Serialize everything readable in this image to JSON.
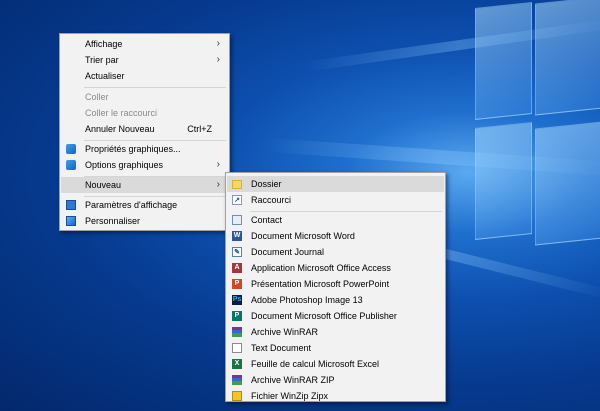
{
  "context_menu": {
    "items": [
      {
        "label": "Affichage",
        "arrow": "›"
      },
      {
        "label": "Trier par",
        "arrow": "›"
      },
      {
        "label": "Actualiser"
      },
      {
        "label": "Coller"
      },
      {
        "label": "Coller le raccourci"
      },
      {
        "label": "Annuler Nouveau",
        "shortcut": "Ctrl+Z"
      },
      {
        "label": "Propriétés graphiques...",
        "icon": "intel-graphics-icon"
      },
      {
        "label": "Options graphiques",
        "arrow": "›",
        "icon": "intel-graphics-icon"
      },
      {
        "label": "Nouveau",
        "arrow": "›"
      },
      {
        "label": "Paramètres d'affichage",
        "icon": "display-settings-icon"
      },
      {
        "label": "Personnaliser",
        "icon": "personalize-icon"
      }
    ]
  },
  "submenu": {
    "items": [
      {
        "label": "Dossier",
        "icon": "folder-icon"
      },
      {
        "label": "Raccourci",
        "icon": "shortcut-icon"
      },
      {
        "label": "Contact",
        "icon": "contact-icon"
      },
      {
        "label": "Document Microsoft Word",
        "icon": "word-icon"
      },
      {
        "label": "Document Journal",
        "icon": "journal-icon"
      },
      {
        "label": "Application Microsoft Office Access",
        "icon": "access-icon"
      },
      {
        "label": "Présentation Microsoft PowerPoint",
        "icon": "powerpoint-icon"
      },
      {
        "label": "Adobe Photoshop Image 13",
        "icon": "photoshop-icon"
      },
      {
        "label": "Document Microsoft Office Publisher",
        "icon": "publisher-icon"
      },
      {
        "label": "Archive WinRAR",
        "icon": "winrar-icon"
      },
      {
        "label": "Text Document",
        "icon": "text-document-icon"
      },
      {
        "label": "Feuille de calcul Microsoft Excel",
        "icon": "excel-icon"
      },
      {
        "label": "Archive WinRAR ZIP",
        "icon": "winrar-zip-icon"
      },
      {
        "label": "Fichier WinZip Zipx",
        "icon": "winzip-icon"
      }
    ]
  },
  "colors": {
    "menu_bg": "#f2f2f2",
    "highlight": "#dadada",
    "desktop": "#0d4fae"
  }
}
